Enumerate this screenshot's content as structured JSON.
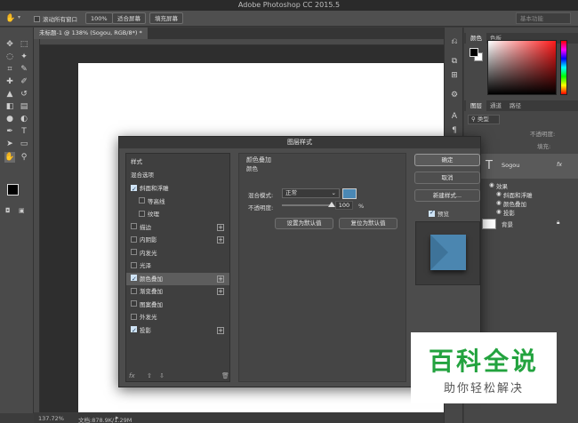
{
  "app": {
    "title": "Adobe Photoshop CC 2015.5"
  },
  "options_bar": {
    "scroll_all_windows": "滚动所有窗口",
    "zoom_100": "100%",
    "fit_screen": "适合屏幕",
    "fill_screen": "填充屏幕",
    "workspace": "基本功能"
  },
  "document": {
    "tab_label": "未标题-1 @ 138% (Sogou, RGB/8*) *"
  },
  "status_bar": {
    "zoom": "137.72%",
    "doc_info": "文档:878.9K/1.29M"
  },
  "panels": {
    "color_tabs": [
      "颜色",
      "色板"
    ],
    "layer_tabs": [
      "图层",
      "通道",
      "路径"
    ],
    "kind_filter": "类型",
    "opacity_label": "不透明度:",
    "fill_label": "填充:",
    "layers": {
      "text_layer_name": "Sogou",
      "effects_label": "效果",
      "effects": [
        "斜面和浮雕",
        "颜色叠加",
        "投影"
      ],
      "bg_layer_name": "背景"
    }
  },
  "dialog": {
    "title": "图层样式",
    "styles_header": "样式",
    "blend_options": "混合选项",
    "style_items": [
      {
        "label": "斜面和浮雕",
        "checked": true,
        "plus": false
      },
      {
        "label": "等高线",
        "checked": false,
        "plus": false
      },
      {
        "label": "纹理",
        "checked": false,
        "plus": false
      },
      {
        "label": "描边",
        "checked": false,
        "plus": true
      },
      {
        "label": "内阴影",
        "checked": false,
        "plus": true
      },
      {
        "label": "内发光",
        "checked": false,
        "plus": false
      },
      {
        "label": "光泽",
        "checked": false,
        "plus": false
      },
      {
        "label": "颜色叠加",
        "checked": true,
        "plus": true,
        "selected": true
      },
      {
        "label": "渐变叠加",
        "checked": false,
        "plus": true
      },
      {
        "label": "图案叠加",
        "checked": false,
        "plus": false
      },
      {
        "label": "外发光",
        "checked": false,
        "plus": false
      },
      {
        "label": "投影",
        "checked": true,
        "plus": true
      }
    ],
    "section_title": "颜色叠加",
    "section_sub": "颜色",
    "blend_mode_label": "混合模式:",
    "blend_mode_value": "正常",
    "overlay_color": "#4a88b5",
    "opacity_label": "不透明度:",
    "opacity_value": "100",
    "percent": "%",
    "opacity_percent": 100,
    "set_default": "设置为默认值",
    "reset_default": "复位为默认值",
    "ok": "确定",
    "cancel": "取消",
    "new_style": "新建样式...",
    "preview_label": "预览",
    "fx_label": "fx"
  },
  "watermark": {
    "title": "百科全说",
    "subtitle": "助你轻松解决"
  }
}
